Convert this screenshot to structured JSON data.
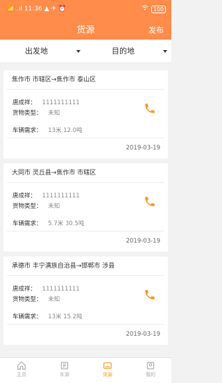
{
  "status_bar": {
    "signal_text": "📶 .ıl",
    "time": "11:36",
    "extra": "▲ ✈ ⏰",
    "battery": "100"
  },
  "header": {
    "title": "货源",
    "publish": "发布"
  },
  "filters": {
    "origin": "出发地",
    "destination": "目的地"
  },
  "cards": [
    {
      "route": "焦作市 市辖区→焦作市 泰山区",
      "contact_label": "唐成祥：",
      "contact_value": "1111111111",
      "cargo_label": "货物类型：",
      "cargo_value": "未知",
      "vehicle_label": "车辆需求：",
      "vehicle_value": "13米  12.0吨",
      "date": "2019-03-19"
    },
    {
      "route": "大同市 灵丘县→焦作市 市辖区",
      "contact_label": "唐成祥：",
      "contact_value": "1111111111",
      "cargo_label": "货物类型：",
      "cargo_value": "未知",
      "vehicle_label": "车辆需求：",
      "vehicle_value": "5.7米  30.5吨",
      "date": "2019-03-19"
    },
    {
      "route": "承德市 丰宁满族自治县→邯郸市 涉县",
      "contact_label": "唐成祥：",
      "contact_value": "1111111111",
      "cargo_label": "货物类型：",
      "cargo_value": "未知",
      "vehicle_label": "车辆需求：",
      "vehicle_value": "13米  15.2吨",
      "date": "2019-03-19"
    }
  ],
  "nav": {
    "home": "主页",
    "cars": "车源",
    "goods": "货源",
    "mine": "我的"
  },
  "icons": {
    "phone": "phone-icon",
    "home": "home-icon",
    "car": "car-icon",
    "goods": "goods-icon",
    "mine": "user-icon",
    "caret": "caret-down-icon"
  },
  "colors": {
    "header": "#ff8c4a",
    "phone": "#f59a23",
    "nav_active": "#f59a23"
  }
}
